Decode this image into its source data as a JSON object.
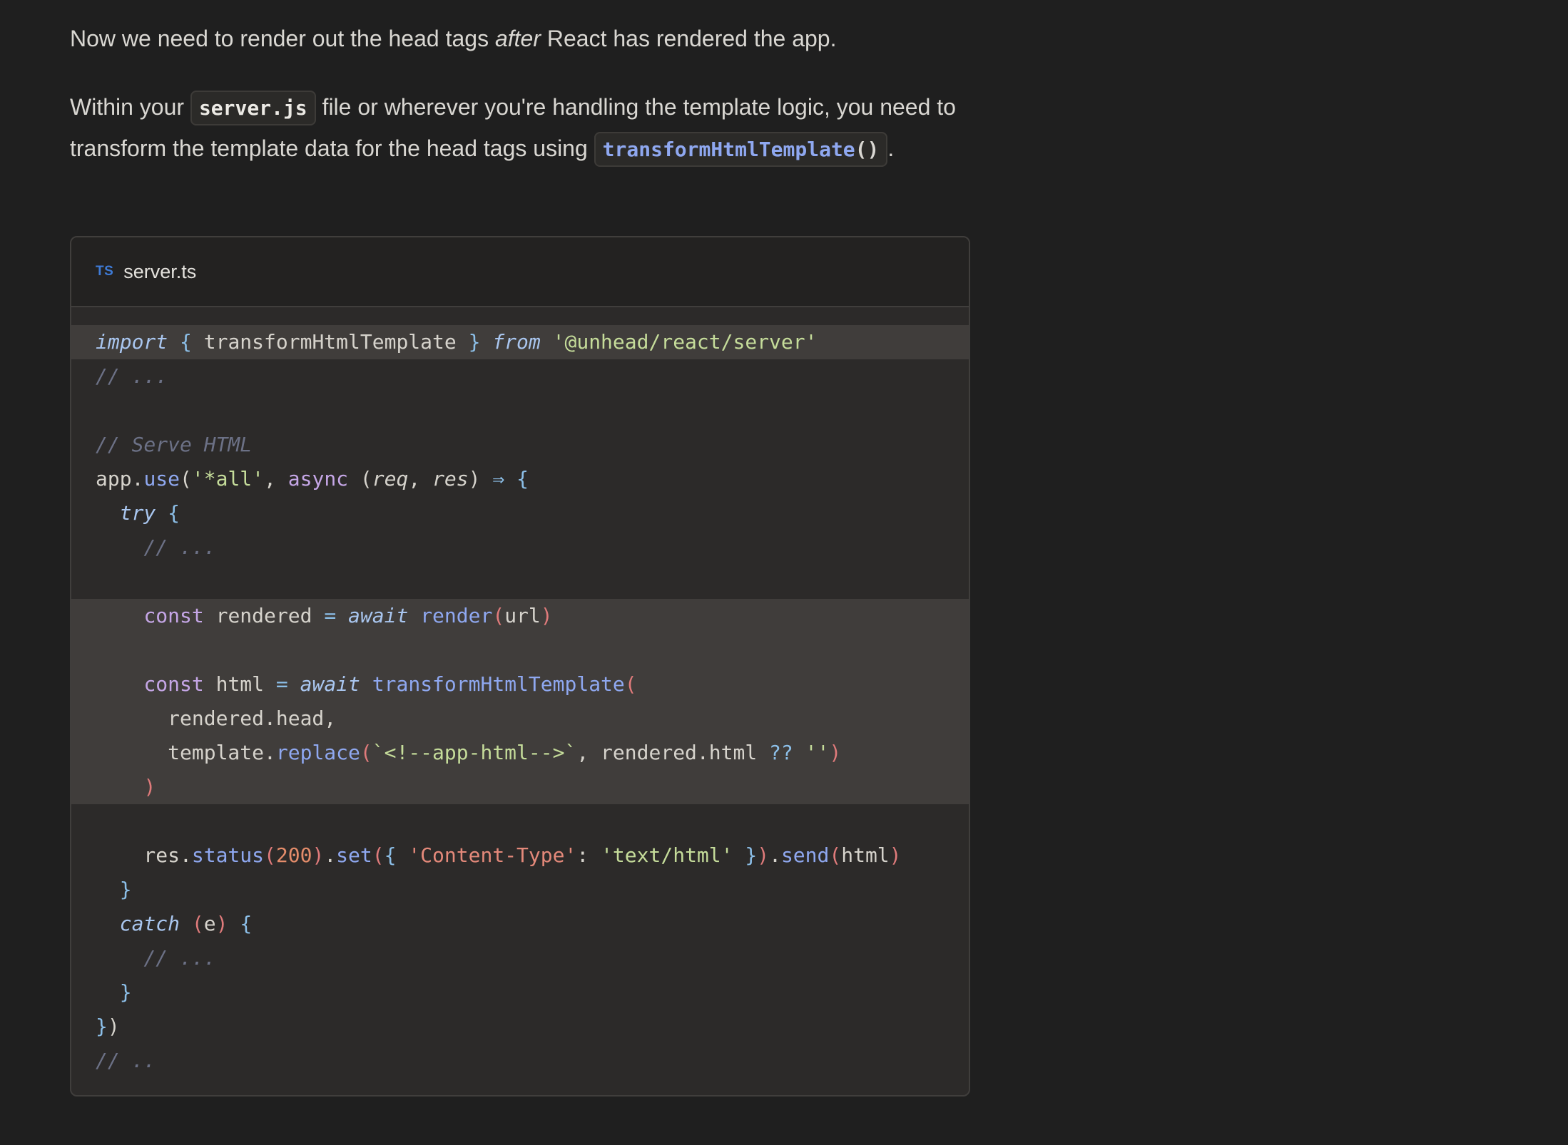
{
  "paragraph1": {
    "before": "Now we need to render out the head tags ",
    "emphasis": "after",
    "after": " React has rendered the app."
  },
  "paragraph2": {
    "before": "Within your ",
    "code1": "server.js",
    "middle": " file or wherever you're handling the template logic, you need to transform the template data for the head tags using ",
    "code2_name": "transformHtmlTemplate",
    "code2_parens": "()",
    "after": "."
  },
  "codeblock": {
    "language_icon": "TS",
    "filename": "server.ts"
  },
  "colors": {
    "background": "#1f1f1f",
    "codeblock_bg": "#2c2a29",
    "highlight_bg": "#403d3b",
    "keyword_purple": "#c5a6e6",
    "function_blue": "#8fa8f0",
    "string_green": "#c5dc9a",
    "comment_gray": "#6c7186"
  }
}
